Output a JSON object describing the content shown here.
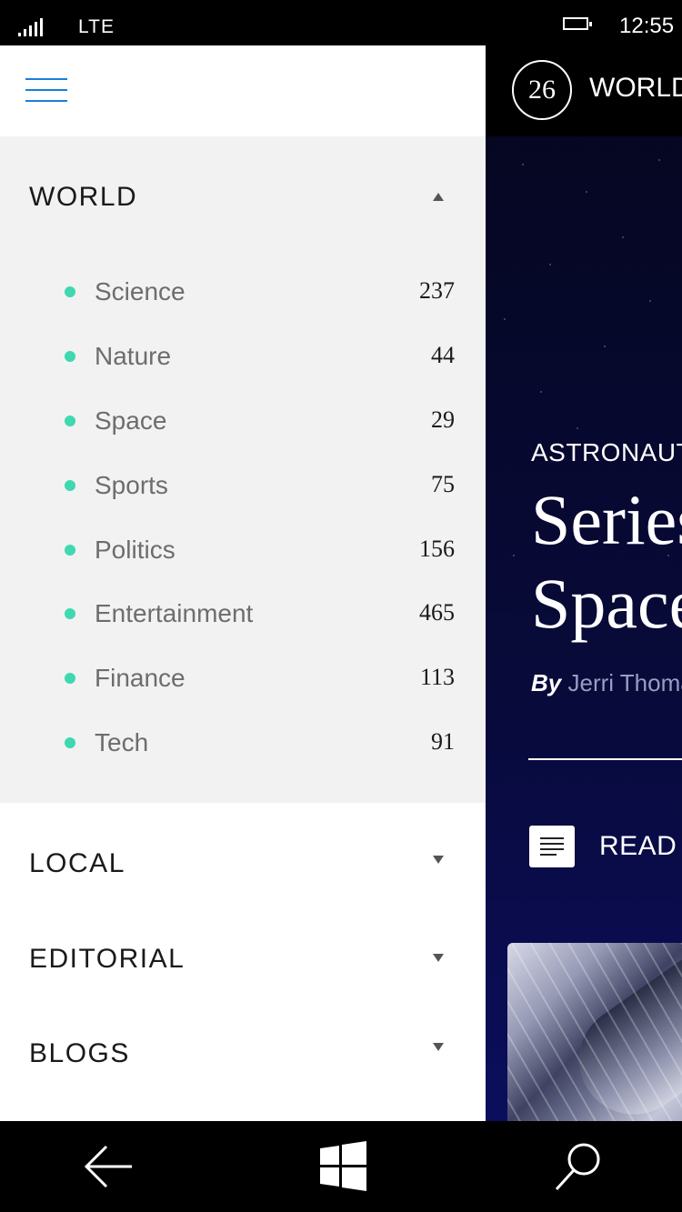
{
  "status": {
    "network": "LTE",
    "time": "12:55"
  },
  "header": {
    "date": "26",
    "section": "WORLD"
  },
  "featured": {
    "kicker": "ASTRONAUTS",
    "headline_line1": "Series",
    "headline_line2": "Space",
    "by": "By",
    "author": "Jerri Thomas",
    "read_label": "READ MORE"
  },
  "menu": {
    "world": {
      "title": "WORLD",
      "items": [
        {
          "label": "Science",
          "count": "237"
        },
        {
          "label": "Nature",
          "count": "44"
        },
        {
          "label": "Space",
          "count": "29"
        },
        {
          "label": "Sports",
          "count": "75"
        },
        {
          "label": "Politics",
          "count": "156"
        },
        {
          "label": "Entertainment",
          "count": "465"
        },
        {
          "label": "Finance",
          "count": "113"
        },
        {
          "label": "Tech",
          "count": "91"
        }
      ]
    },
    "local": {
      "title": "LOCAL"
    },
    "editorial": {
      "title": "EDITORIAL"
    },
    "blogs": {
      "title": "BLOGS"
    }
  },
  "colors": {
    "accent": "#1a7fd6",
    "dot": "#3fd8b1",
    "panel": "#f2f2f2"
  }
}
